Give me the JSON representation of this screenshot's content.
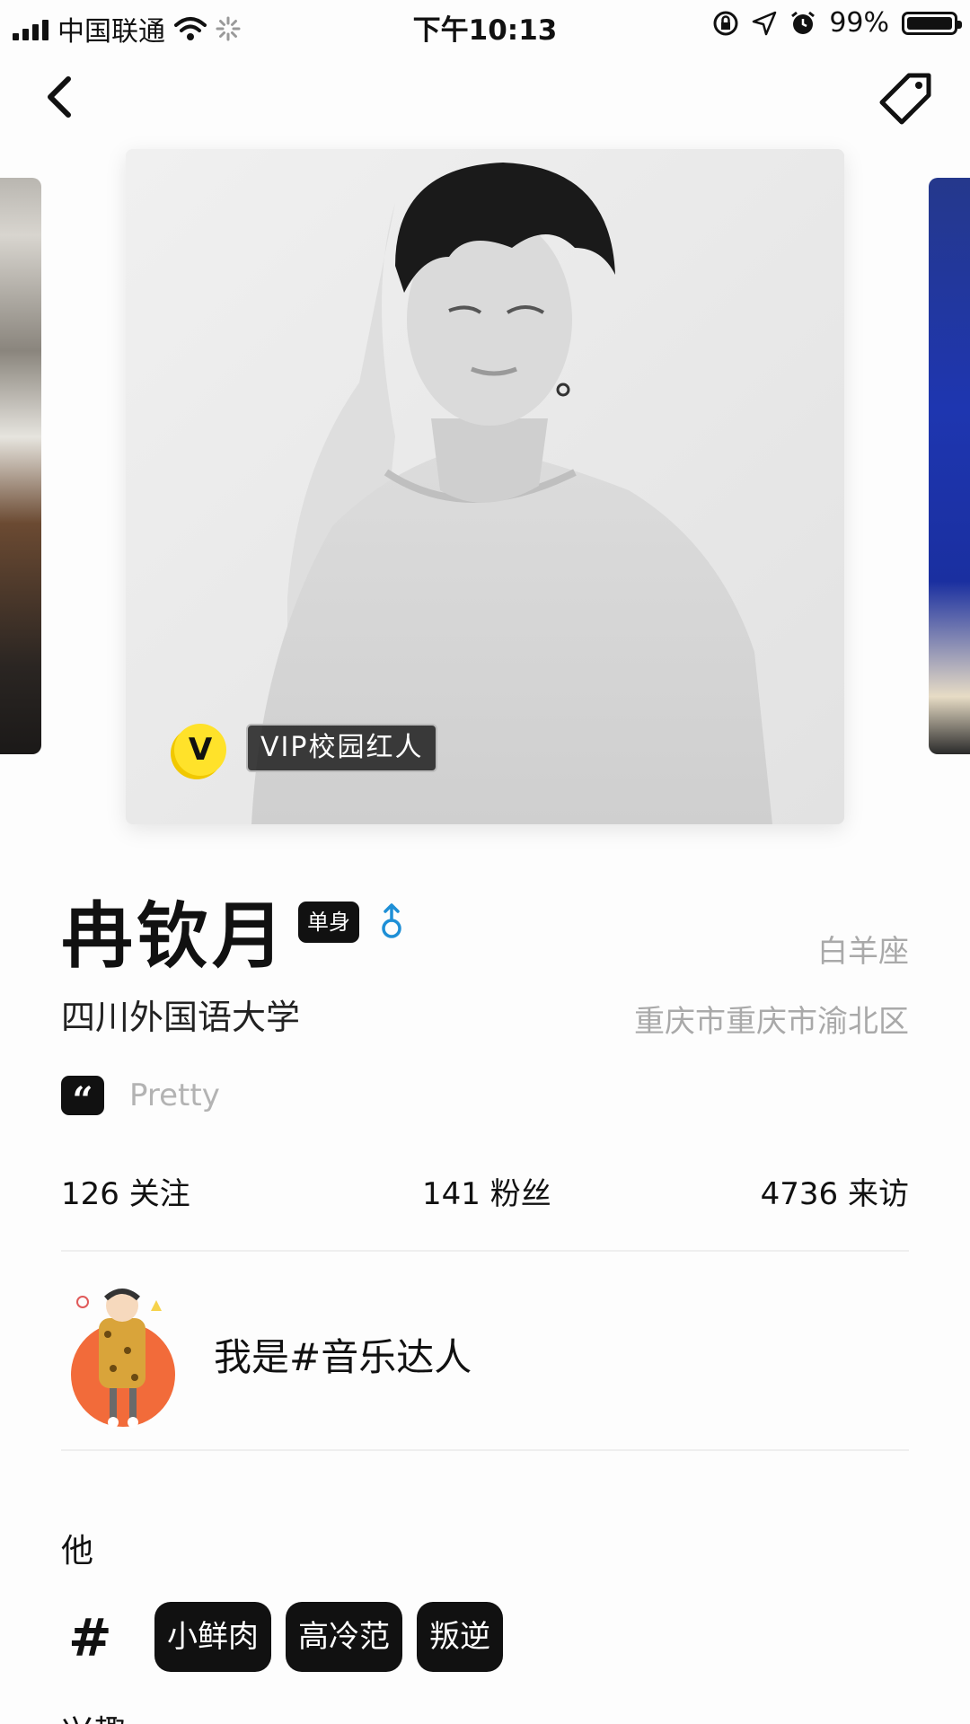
{
  "status_bar": {
    "carrier": "中国联通",
    "time": "下午10:13",
    "battery": "99%"
  },
  "photo": {
    "vip_badge_letter": "V",
    "vip_label": "VIP校园红人"
  },
  "profile": {
    "name": "冉钦月",
    "relationship_status": "单身",
    "zodiac": "白羊座",
    "school": "四川外国语大学",
    "location": "重庆市重庆市渝北区",
    "bio": "Pretty"
  },
  "stats": [
    {
      "value": "126",
      "label": "关注"
    },
    {
      "value": "141",
      "label": "粉丝"
    },
    {
      "value": "4736",
      "label": "来访"
    }
  ],
  "badge": {
    "title": "我是#音乐达人"
  },
  "about": {
    "section_title": "他",
    "hash_symbol": "#",
    "tags": [
      "小鲜肉",
      "高冷范",
      "叛逆"
    ],
    "next_section_title": "兴趣"
  },
  "colors": {
    "vip_yellow": "#ffe22a",
    "gender_blue": "#1e8fd6",
    "secondary_text": "#a9a9a9",
    "badge_orange": "#f26b3a"
  }
}
